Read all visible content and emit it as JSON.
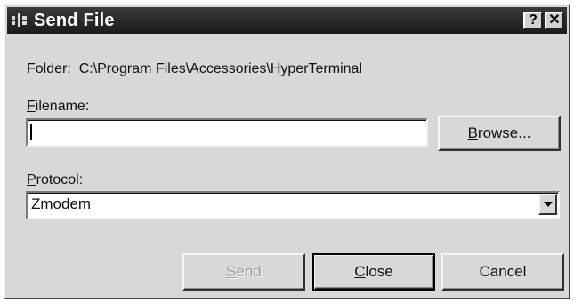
{
  "window": {
    "title": "Send File",
    "help_button": "?",
    "close_button": "✕"
  },
  "folder": {
    "label": "Folder:",
    "path": "C:\\Program Files\\Accessories\\HyperTerminal"
  },
  "filename": {
    "label_accel": "F",
    "label_rest": "ilename:",
    "value": ""
  },
  "browse_button": {
    "accel": "B",
    "rest": "rowse..."
  },
  "protocol": {
    "label_accel": "P",
    "label_rest": "rotocol:",
    "selected": "Zmodem"
  },
  "buttons": {
    "send": {
      "accel": "S",
      "rest": "end",
      "enabled": false
    },
    "close": {
      "accel": "C",
      "rest": "lose"
    },
    "cancel": {
      "label": "Cancel"
    }
  }
}
